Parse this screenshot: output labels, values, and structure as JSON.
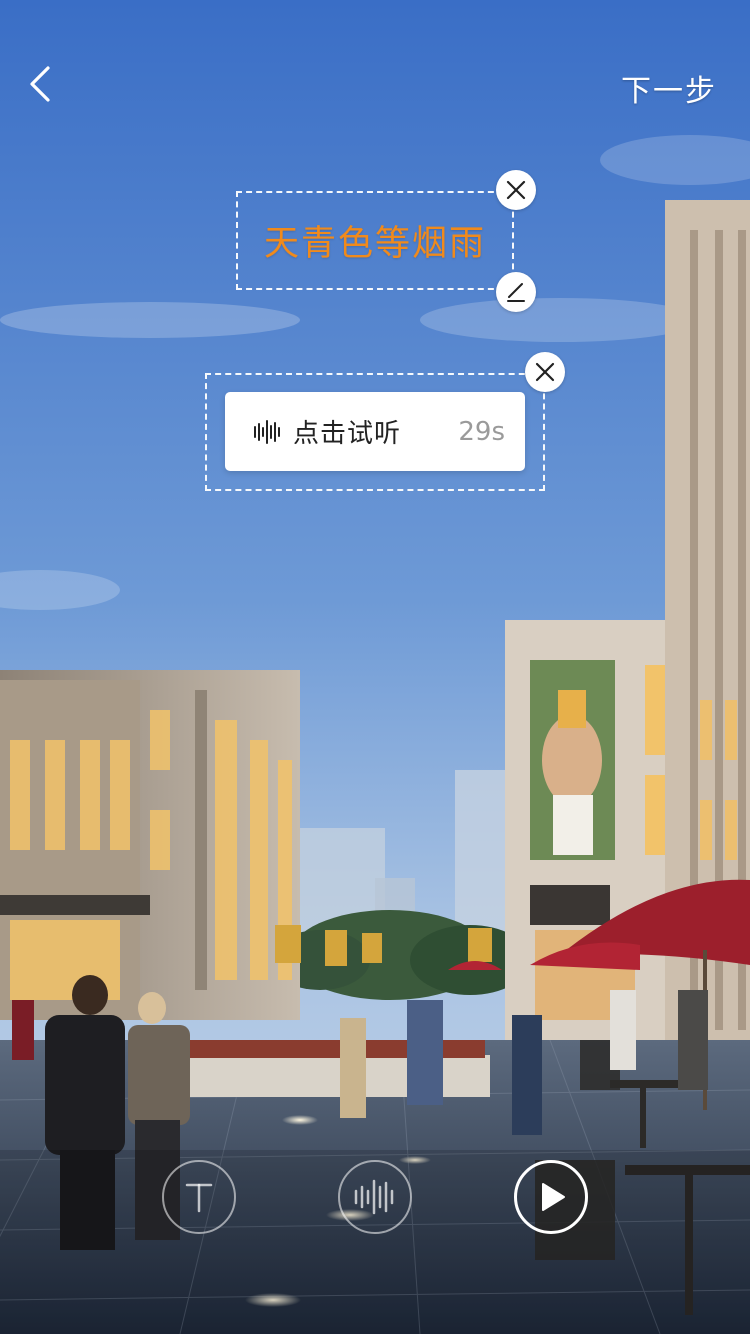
{
  "header": {
    "next_label": "下一步"
  },
  "text_sticker": {
    "text": "天青色等烟雨",
    "color": "#f08a1c"
  },
  "audio_sticker": {
    "label": "点击试听",
    "duration": "29s"
  },
  "toolbar": {
    "items": [
      "text-tool",
      "voice-tool",
      "play-preview"
    ]
  },
  "colors": {
    "accent": "#f08a1c",
    "sky_top": "#3f73c9",
    "card_bg": "#ffffff"
  }
}
